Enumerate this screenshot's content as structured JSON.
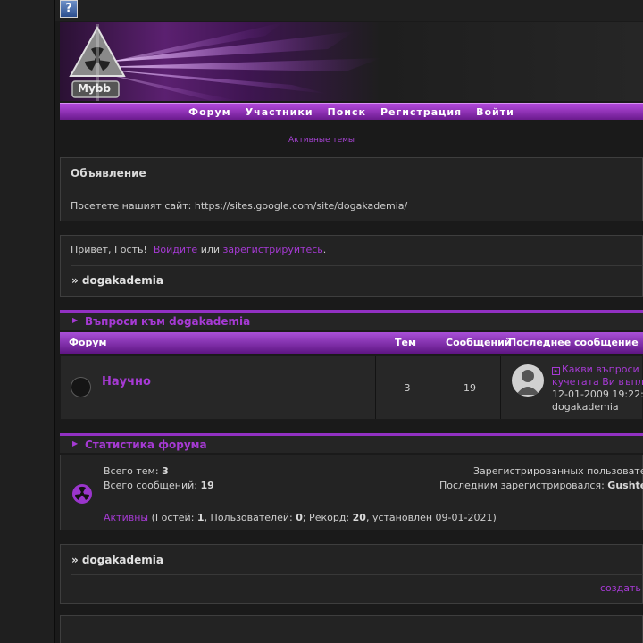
{
  "help_icon": {
    "glyph": "?"
  },
  "logo": {
    "label": "Mybb"
  },
  "nav": {
    "items": [
      "Форум",
      "Участники",
      "Поиск",
      "Регистрация",
      "Войти"
    ]
  },
  "active_topics_link": "Активные темы",
  "announcement": {
    "title": "Объявление",
    "text": "Посетете нашият сайт: https://sites.google.com/site/dogakademia/"
  },
  "greeting": {
    "hello": "Привет, Гость!",
    "login": "Войдите",
    "or": "или",
    "register": "зарегистрируйтесь",
    "end": ".",
    "breadcrumb": "» dogakademia"
  },
  "category": {
    "title": "Въпроси към dogakademia",
    "columns": {
      "forum": "Форум",
      "topics": "Тем",
      "posts": "Сообщений",
      "last_post": "Последнее сообщение"
    }
  },
  "forum_row": {
    "name": "Научно",
    "topics": "3",
    "posts": "19",
    "last_post_title_1": "Какви въпроси",
    "last_post_title_2": "кучетата Ви въпл",
    "last_post_date": "12-01-2009 19:22:",
    "last_post_author": "dogakademia"
  },
  "stats": {
    "title": "Статистика форума",
    "total_topics_label": "Всего тем:",
    "total_topics": "3",
    "total_posts_label": "Всего сообщений:",
    "total_posts": "19",
    "registered_label": "Зарегистрированных пользовате",
    "last_registered_label": "Последним зарегистрировался:",
    "last_registered_user": "Gushte",
    "active_label": "Активны",
    "guests_text": "(Гостей:",
    "guests": "1",
    "users_text": ", Пользователей:",
    "users": "0",
    "record_text": "; Рекорд:",
    "record": "20",
    "record_date_text": ", установлен 09-01-2021)"
  },
  "footer_crumb": {
    "breadcrumb": "» dogakademia",
    "create": "создать"
  },
  "colors": {
    "accent": "#a63ad4",
    "nav_top": "#b44ade",
    "nav_bottom": "#6b1a8e",
    "background": "#1a1a1a"
  }
}
